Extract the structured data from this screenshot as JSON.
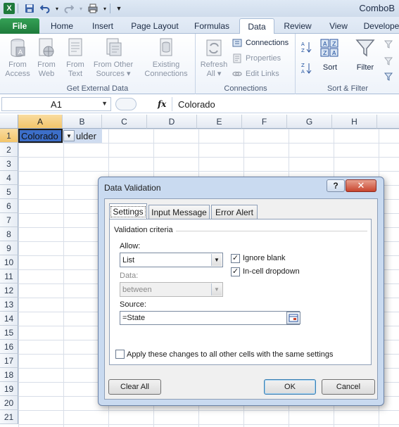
{
  "window": {
    "title": "ComboB"
  },
  "ribbon": {
    "tabs": [
      "File",
      "Home",
      "Insert",
      "Page Layout",
      "Formulas",
      "Data",
      "Review",
      "View",
      "Develope"
    ],
    "active_tab": "Data",
    "groups": {
      "get_external_data": {
        "label": "Get External Data",
        "buttons": [
          {
            "line1": "From",
            "line2": "Access"
          },
          {
            "line1": "From",
            "line2": "Web"
          },
          {
            "line1": "From",
            "line2": "Text"
          },
          {
            "line1": "From Other",
            "line2": "Sources ▾"
          },
          {
            "line1": "Existing",
            "line2": "Connections"
          }
        ]
      },
      "connections": {
        "label": "Connections",
        "refresh": {
          "line1": "Refresh",
          "line2": "All ▾"
        },
        "connections_label": "Connections",
        "properties_label": "Properties",
        "edit_links_label": "Edit Links"
      },
      "sort_filter": {
        "label": "Sort & Filter",
        "sort_label": "Sort",
        "filter_label": "Filter"
      }
    }
  },
  "formula_bar": {
    "name_box": "A1",
    "fx": "fx",
    "value": "Colorado"
  },
  "sheet": {
    "columns": [
      "A",
      "B",
      "C",
      "D",
      "E",
      "F",
      "G",
      "H"
    ],
    "rows": [
      "1",
      "2",
      "3",
      "4",
      "5",
      "6",
      "7",
      "8",
      "9",
      "10",
      "11",
      "12",
      "13",
      "14",
      "15",
      "16",
      "17",
      "18",
      "19",
      "20",
      "21"
    ],
    "cell_a1": "Colorado",
    "cell_b1_partial": "ulder"
  },
  "dialog": {
    "title": "Data Validation",
    "help": "?",
    "close": "✕",
    "tabs": [
      "Settings",
      "Input Message",
      "Error Alert"
    ],
    "active_tab": "Settings",
    "section_label": "Validation criteria",
    "allow_label": "Allow:",
    "allow_value": "List",
    "ignore_blank": {
      "label": "Ignore blank",
      "checked": true
    },
    "in_cell_dropdown": {
      "label": "In-cell dropdown",
      "checked": true
    },
    "data_label": "Data:",
    "data_value": "between",
    "source_label": "Source:",
    "source_value": "=State",
    "apply_all": {
      "label": "Apply these changes to all other cells with the same settings",
      "checked": false
    },
    "buttons": {
      "clear_all": "Clear All",
      "ok": "OK",
      "cancel": "Cancel"
    }
  }
}
